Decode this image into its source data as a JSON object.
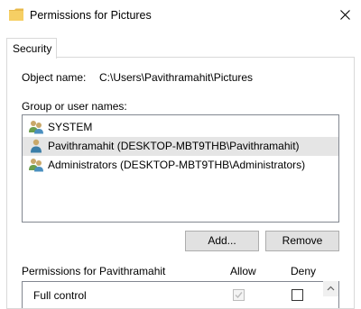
{
  "window": {
    "title": "Permissions for Pictures",
    "close_glyph": "✕"
  },
  "tabs": [
    {
      "label": "Security",
      "selected": true
    }
  ],
  "object": {
    "label": "Object name:",
    "value": "C:\\Users\\Pavithramahit\\Pictures"
  },
  "group": {
    "label": "Group or user names:",
    "items": [
      {
        "label": "SYSTEM",
        "icon": "user-group-icon",
        "selected": false
      },
      {
        "label": "Pavithramahit (DESKTOP-MBT9THB\\Pavithramahit)",
        "icon": "user-icon",
        "selected": true
      },
      {
        "label": "Administrators (DESKTOP-MBT9THB\\Administrators)",
        "icon": "user-group-icon",
        "selected": false
      }
    ]
  },
  "buttons": {
    "add": "Add...",
    "remove": "Remove"
  },
  "permissions": {
    "label": "Permissions for Pavithramahit",
    "allow_header": "Allow",
    "deny_header": "Deny",
    "rows": [
      {
        "label": "Full control",
        "allow": true,
        "allow_disabled": true,
        "deny": false
      }
    ]
  },
  "colors": {
    "selected_row": "#e5e5e5",
    "button_bg": "#e1e1e1",
    "border": "#828790"
  }
}
